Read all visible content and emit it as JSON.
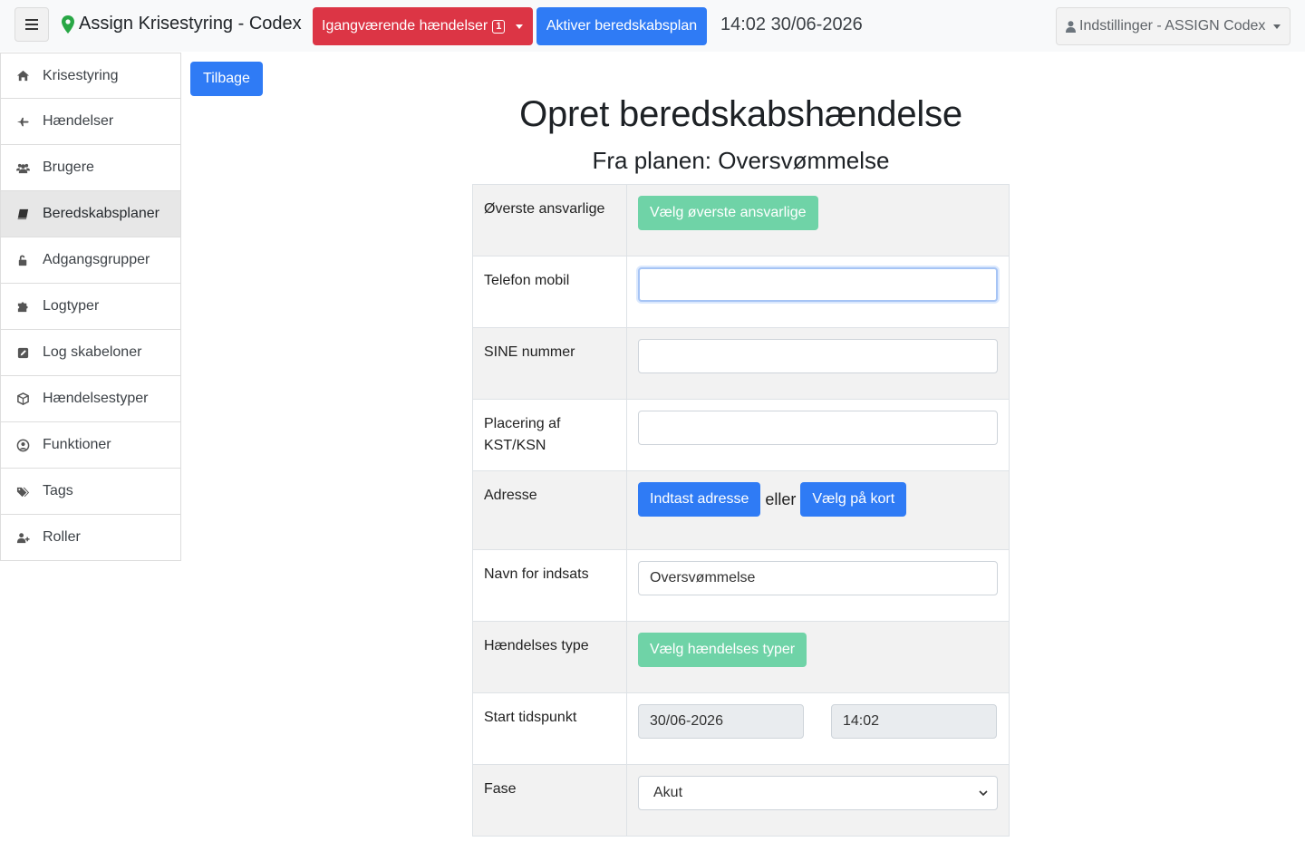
{
  "header": {
    "app_title": "Assign Krisestyring - Codex",
    "ongoing_label": "Igangværende hændelser",
    "ongoing_count": "1",
    "activate_label": "Aktiver beredskabsplan",
    "datetime": "14:02 30/06-2026",
    "settings_label": "Indstillinger - ASSIGN Codex"
  },
  "sidebar": {
    "items": [
      {
        "label": "Krisestyring",
        "icon": "home-icon"
      },
      {
        "label": "Hændelser",
        "icon": "plane-icon"
      },
      {
        "label": "Brugere",
        "icon": "users-icon"
      },
      {
        "label": "Beredskabsplaner",
        "icon": "book-icon",
        "active": true
      },
      {
        "label": "Adgangsgrupper",
        "icon": "unlock-icon"
      },
      {
        "label": "Logtyper",
        "icon": "puzzle-icon"
      },
      {
        "label": "Log skabeloner",
        "icon": "edit-icon"
      },
      {
        "label": "Hændelsestyper",
        "icon": "cube-icon"
      },
      {
        "label": "Funktioner",
        "icon": "user-circle-icon"
      },
      {
        "label": "Tags",
        "icon": "tags-icon"
      },
      {
        "label": "Roller",
        "icon": "user-plus-icon"
      }
    ]
  },
  "main": {
    "back_label": "Tilbage",
    "title": "Opret beredskabshændelse",
    "subtitle": "Fra planen: Oversvømmelse"
  },
  "form": {
    "top_responsible_label": "Øverste ansvarlige",
    "top_responsible_button": "Vælg øverste ansvarlige",
    "phone_label": "Telefon mobil",
    "phone_value": "",
    "sine_label": "SINE nummer",
    "sine_value": "",
    "placement_label": "Placering af KST/KSN",
    "placement_value": "",
    "address_label": "Adresse",
    "address_enter_button": "Indtast adresse",
    "address_or": "eller",
    "address_map_button": "Vælg på kort",
    "operation_name_label": "Navn for indsats",
    "operation_name_value": "Oversvømmelse",
    "event_type_label": "Hændelses type",
    "event_type_button": "Vælg hændelses typer",
    "start_label": "Start tidspunkt",
    "start_date": "30/06-2026",
    "start_time": "14:02",
    "phase_label": "Fase",
    "phase_selected": "Akut"
  },
  "colors": {
    "primary": "#2f7bf5",
    "danger": "#dc3545",
    "success_light": "#6fd3a7",
    "pin": "#28a745"
  }
}
